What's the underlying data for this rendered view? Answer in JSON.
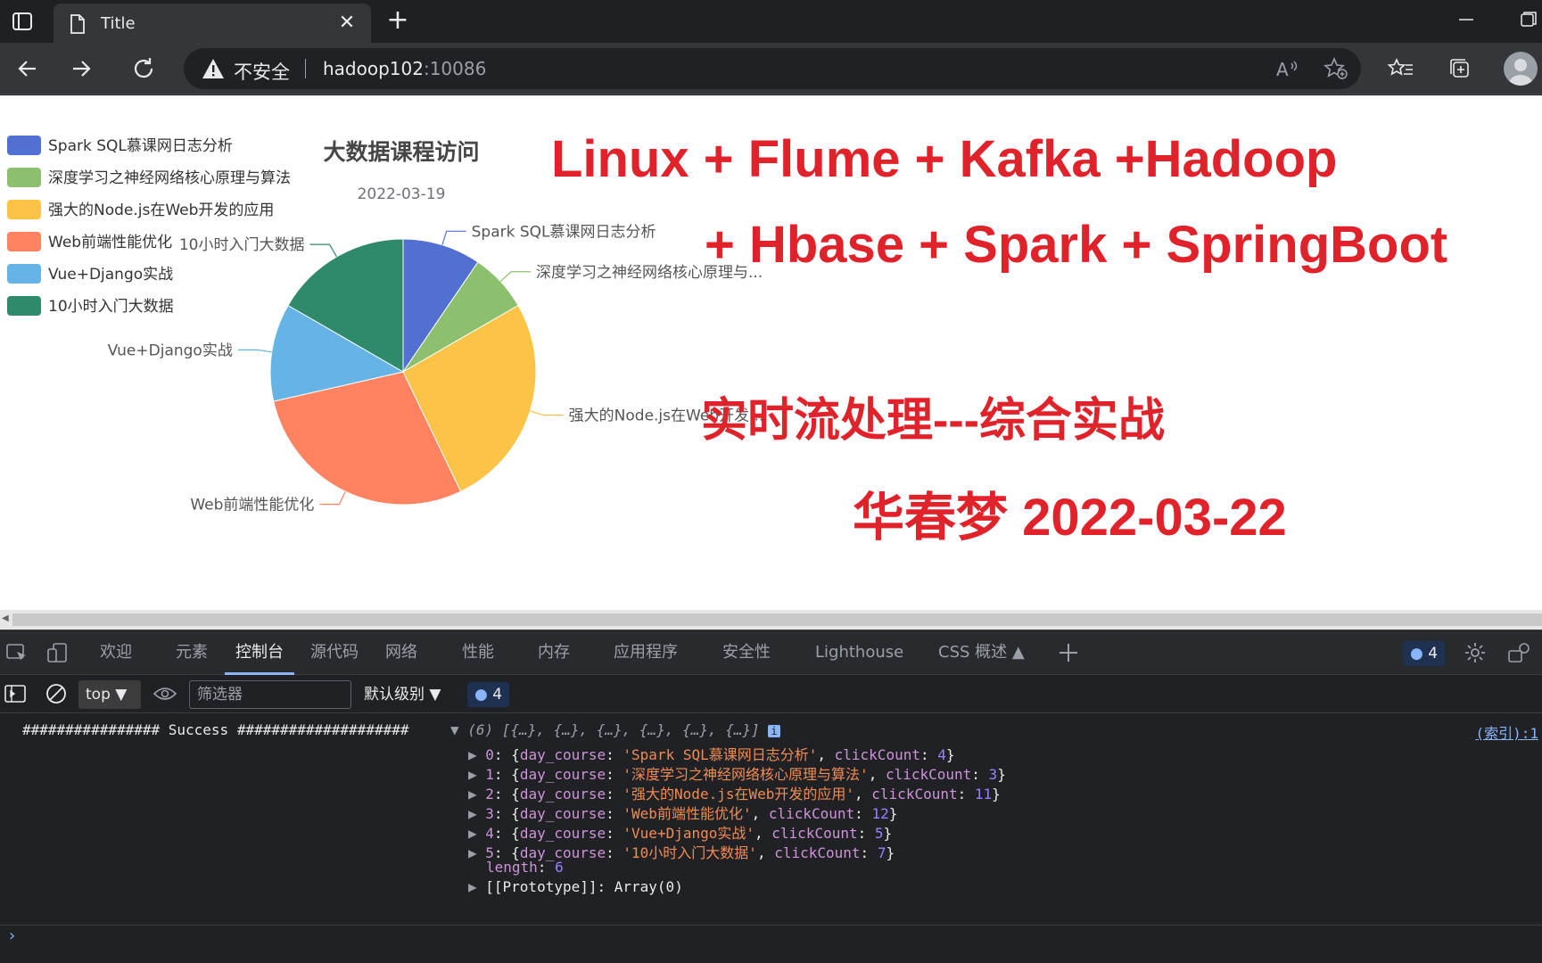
{
  "browser": {
    "tab_title": "Title",
    "tab_close": "✕",
    "new_tab": "+",
    "address": {
      "security_text": "不安全",
      "host": "hadoop102",
      "port": ":10086"
    }
  },
  "page": {
    "overlay": {
      "line1": "Linux + Flume + Kafka +Hadoop",
      "line2": "+ Hbase + Spark + SpringBoot",
      "line3": "实时流处理---综合实战",
      "line4": "华春梦 2022-03-22",
      "color": "#e0222b"
    }
  },
  "chart_data": {
    "type": "pie",
    "title": "大数据课程访问",
    "subtitle": "2022-03-19",
    "legend_position": "top-left",
    "categories": [
      "Spark SQL慕课网日志分析",
      "深度学习之神经网络核心原理与算法",
      "强大的Node.js在Web开发的应用",
      "Web前端性能优化",
      "Vue+Django实战",
      "10小时入门大数据"
    ],
    "slice_labels": [
      "Spark SQL慕课网日志分析",
      "深度学习之神经网络核心原理与...",
      "强大的Node.js在Web开发...",
      "Web前端性能优化",
      "Vue+Django实战",
      "10小时入门大数据"
    ],
    "values": [
      4,
      3,
      11,
      12,
      5,
      7
    ],
    "colors": [
      "#5470c6",
      "#91cc75",
      "#fac858",
      "#ee6666",
      "#73c0de",
      "#3ba272"
    ],
    "render_colors": [
      "#5170d2",
      "#8dc06e",
      "#fcc446",
      "#ff8360",
      "#66b4e6",
      "#2e8a6a"
    ]
  },
  "devtools": {
    "tabs": [
      "欢迎",
      "元素",
      "控制台",
      "源代码",
      "网络",
      "性能",
      "内存",
      "应用程序",
      "安全性",
      "Lighthouse",
      "CSS 概述 ▲"
    ],
    "active_tab": "控制台",
    "issues_count": "4",
    "context": "top",
    "filter_placeholder": "筛选器",
    "level": "默认级别",
    "message_count": "4",
    "console": {
      "log_prefix": "################ Success ####################",
      "array_summary": "(6) [{…}, {…}, {…}, {…}, {…}, {…}]",
      "source_link": "(索引):1",
      "entries": [
        {
          "index": "0",
          "day_course": "Spark SQL慕课网日志分析",
          "clickCount": "4"
        },
        {
          "index": "1",
          "day_course": "深度学习之神经网络核心原理与算法",
          "clickCount": "3"
        },
        {
          "index": "2",
          "day_course": "强大的Node.js在Web开发的应用",
          "clickCount": "11"
        },
        {
          "index": "3",
          "day_course": "Web前端性能优化",
          "clickCount": "12"
        },
        {
          "index": "4",
          "day_course": "Vue+Django实战",
          "clickCount": "5"
        },
        {
          "index": "5",
          "day_course": "10小时入门大数据",
          "clickCount": "7"
        }
      ],
      "length_label": "length",
      "length_value": "6",
      "prototype_text": "[[Prototype]]: Array(0)"
    }
  }
}
